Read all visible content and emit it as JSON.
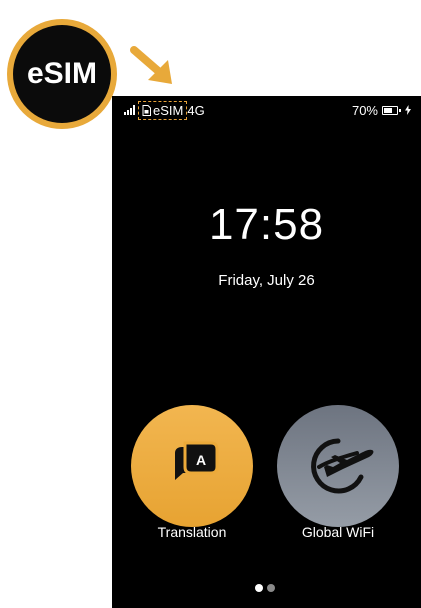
{
  "badge": {
    "label": "eSIM"
  },
  "status_bar": {
    "sim_label": "eSIM",
    "network": "4G",
    "battery_percent": "70%",
    "battery_level": 0.7
  },
  "lock_screen": {
    "time": "17:58",
    "date": "Friday, July 26"
  },
  "apps": [
    {
      "label": "Translation",
      "icon": "translation-chat-icon",
      "color": "#ecaa3a"
    },
    {
      "label": "Global WiFi",
      "icon": "globe-airplane-icon",
      "color": "#7d848f"
    }
  ],
  "pager": {
    "page_count": 2,
    "current_page": 1
  },
  "colors": {
    "accent": "#e8a93a",
    "background": "#000000"
  }
}
